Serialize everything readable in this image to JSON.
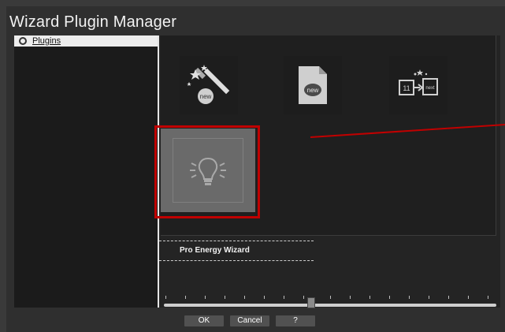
{
  "window": {
    "title": "Wizard Plugin Manager"
  },
  "sidebar": {
    "items": [
      {
        "label": "Plugins",
        "selected": true
      }
    ]
  },
  "plugins": [
    {
      "icon": "magic-wand-new-icon",
      "state": "normal"
    },
    {
      "icon": "new-document-icon",
      "state": "normal"
    },
    {
      "icon": "transfer-next-icon",
      "state": "normal"
    },
    {
      "icon": "lightbulb-icon",
      "state": "selected"
    }
  ],
  "details": {
    "name": "Pro Energy Wizard"
  },
  "slider": {
    "value_fraction": 0.44
  },
  "buttons": {
    "ok": "OK",
    "cancel": "Cancel",
    "help": "?"
  },
  "colors": {
    "highlight": "#c00000",
    "window_bg": "#2f2f2f"
  }
}
